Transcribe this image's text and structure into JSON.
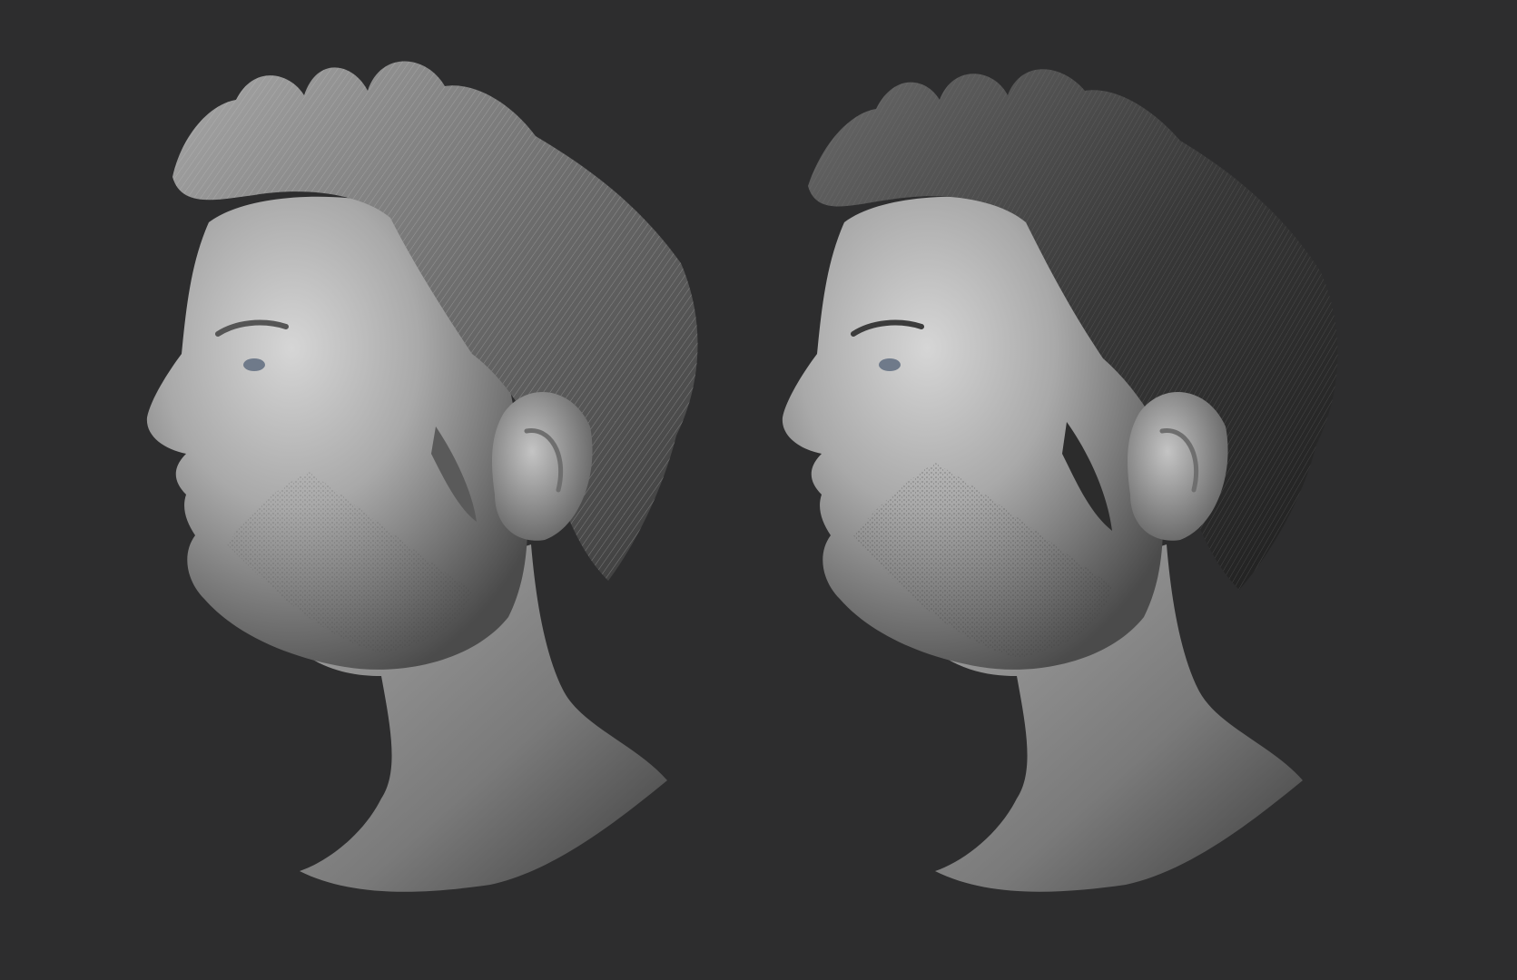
{
  "scene": {
    "background": "#2d2d2e",
    "clay_light": "#cfcfcf",
    "clay_mid": "#8d8d8d",
    "clay_dark": "#4a4a4a",
    "busts": [
      {
        "name": "bust-left",
        "hair_tone": "light-grey",
        "hair_color": "#6f6f6f",
        "hair_highlight": "#b9b9b9"
      },
      {
        "name": "bust-right",
        "hair_tone": "dark-grey",
        "hair_color": "#3a3a3a",
        "hair_highlight": "#8a8a8a"
      }
    ]
  }
}
